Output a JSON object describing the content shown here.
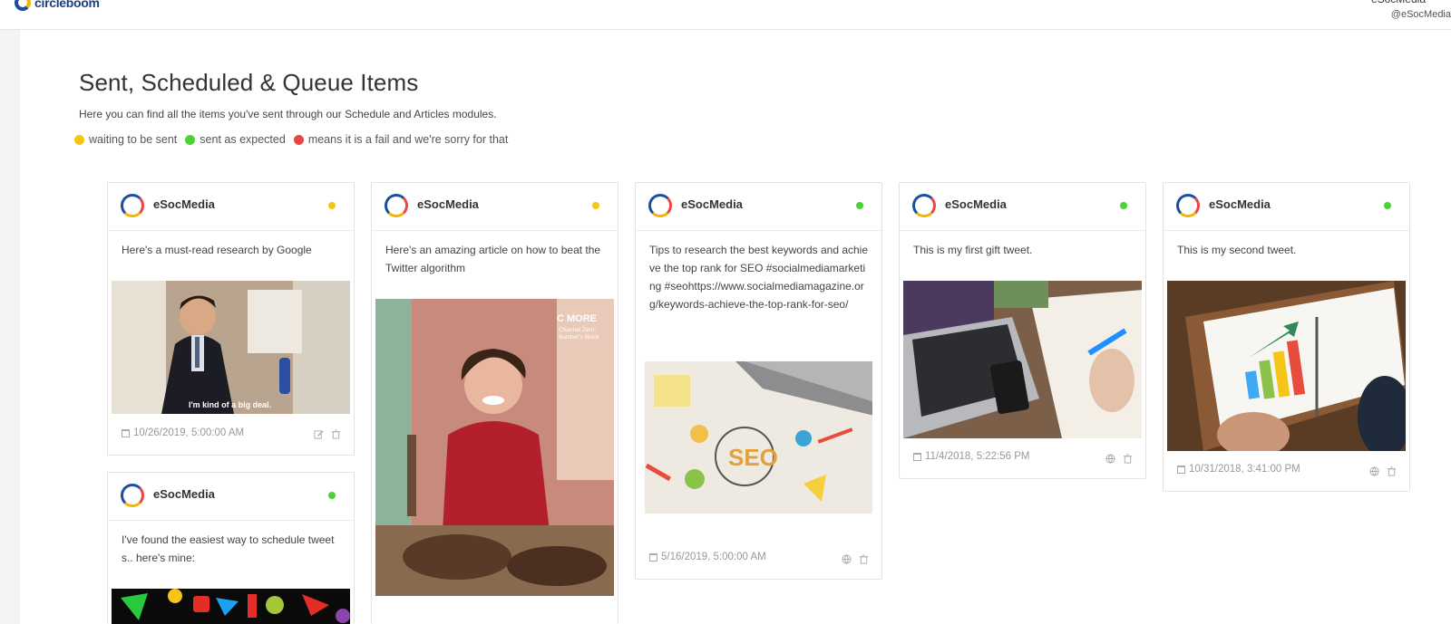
{
  "header": {
    "logo_text": "circleboom",
    "user_name": "eSocMedia",
    "user_handle": "@eSocMedia"
  },
  "page": {
    "title": "Sent, Scheduled & Queue Items",
    "subtitle": "Here you can find all the items you've sent through our Schedule and Articles modules.",
    "legend": [
      {
        "label": "waiting to be sent",
        "color": "#f5c518"
      },
      {
        "label": "sent as expected",
        "color": "#4cd137"
      },
      {
        "label": "means it is a fail and we're sorry for that",
        "color": "#e84545"
      }
    ]
  },
  "colors": {
    "waiting": "#f5c518",
    "sent": "#4cd137",
    "fail": "#e84545"
  },
  "cards": [
    {
      "name": "eSocMedia",
      "status": "waiting",
      "text": "Here's a must-read research by Google",
      "date": "10/26/2019, 5:00:00 AM",
      "image_caption": "I'm kind of a big deal.",
      "actions": [
        "edit-icon",
        "trash-icon"
      ]
    },
    {
      "name": "eSocMedia",
      "status": "waiting",
      "text": "Here's an amazing article on how to beat the Twitter algorithm",
      "date": "",
      "image_caption": "C MORE",
      "image_caption2": "Channel Zero: Butcher's Block",
      "actions": []
    },
    {
      "name": "eSocMedia",
      "status": "sent",
      "text": "Tips to research the best keywords and achieve the top rank for SEO #socialmediamarketing #seohttps://www.socialmediamagazine.org/keywords-achieve-the-top-rank-for-seo/",
      "date": "5/16/2019, 5:00:00 AM",
      "actions": [
        "globe-icon",
        "trash-icon"
      ]
    },
    {
      "name": "eSocMedia",
      "status": "sent",
      "text": "This is my first gift tweet.",
      "date": "11/4/2018, 5:22:56 PM",
      "actions": [
        "globe-icon",
        "trash-icon"
      ]
    },
    {
      "name": "eSocMedia",
      "status": "sent",
      "text": "This is my second tweet.",
      "date": "10/31/2018, 3:41:00 PM",
      "actions": [
        "globe-icon",
        "trash-icon"
      ]
    },
    {
      "name": "eSocMedia",
      "status": "sent",
      "text": "I've found the easiest way to schedule tweets.. here's mine:",
      "date": "",
      "actions": []
    }
  ]
}
